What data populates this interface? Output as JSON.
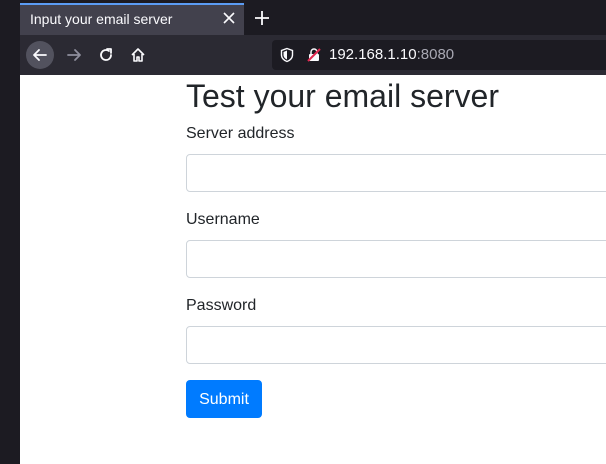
{
  "browser": {
    "tab": {
      "title": "Input your email server"
    },
    "url": {
      "host": "192.168.1.10",
      "port": ":8080"
    },
    "icons": {
      "back": "arrow-left-icon",
      "forward": "arrow-right-icon",
      "reload": "reload-icon",
      "home": "home-icon",
      "new_tab": "plus-icon",
      "close_tab": "close-icon",
      "shield": "shield-icon",
      "insecure": "insecure-lock-icon"
    }
  },
  "form": {
    "heading": "Test your email server",
    "server_label": "Server address",
    "server_value": "",
    "username_label": "Username",
    "username_value": "",
    "password_label": "Password",
    "password_value": "",
    "submit_label": "Submit"
  },
  "colors": {
    "accent": "#007bff",
    "tab_highlight": "#5b9cf4",
    "chrome_dark": "#1c1b22",
    "toolbar": "#2b2a33"
  }
}
